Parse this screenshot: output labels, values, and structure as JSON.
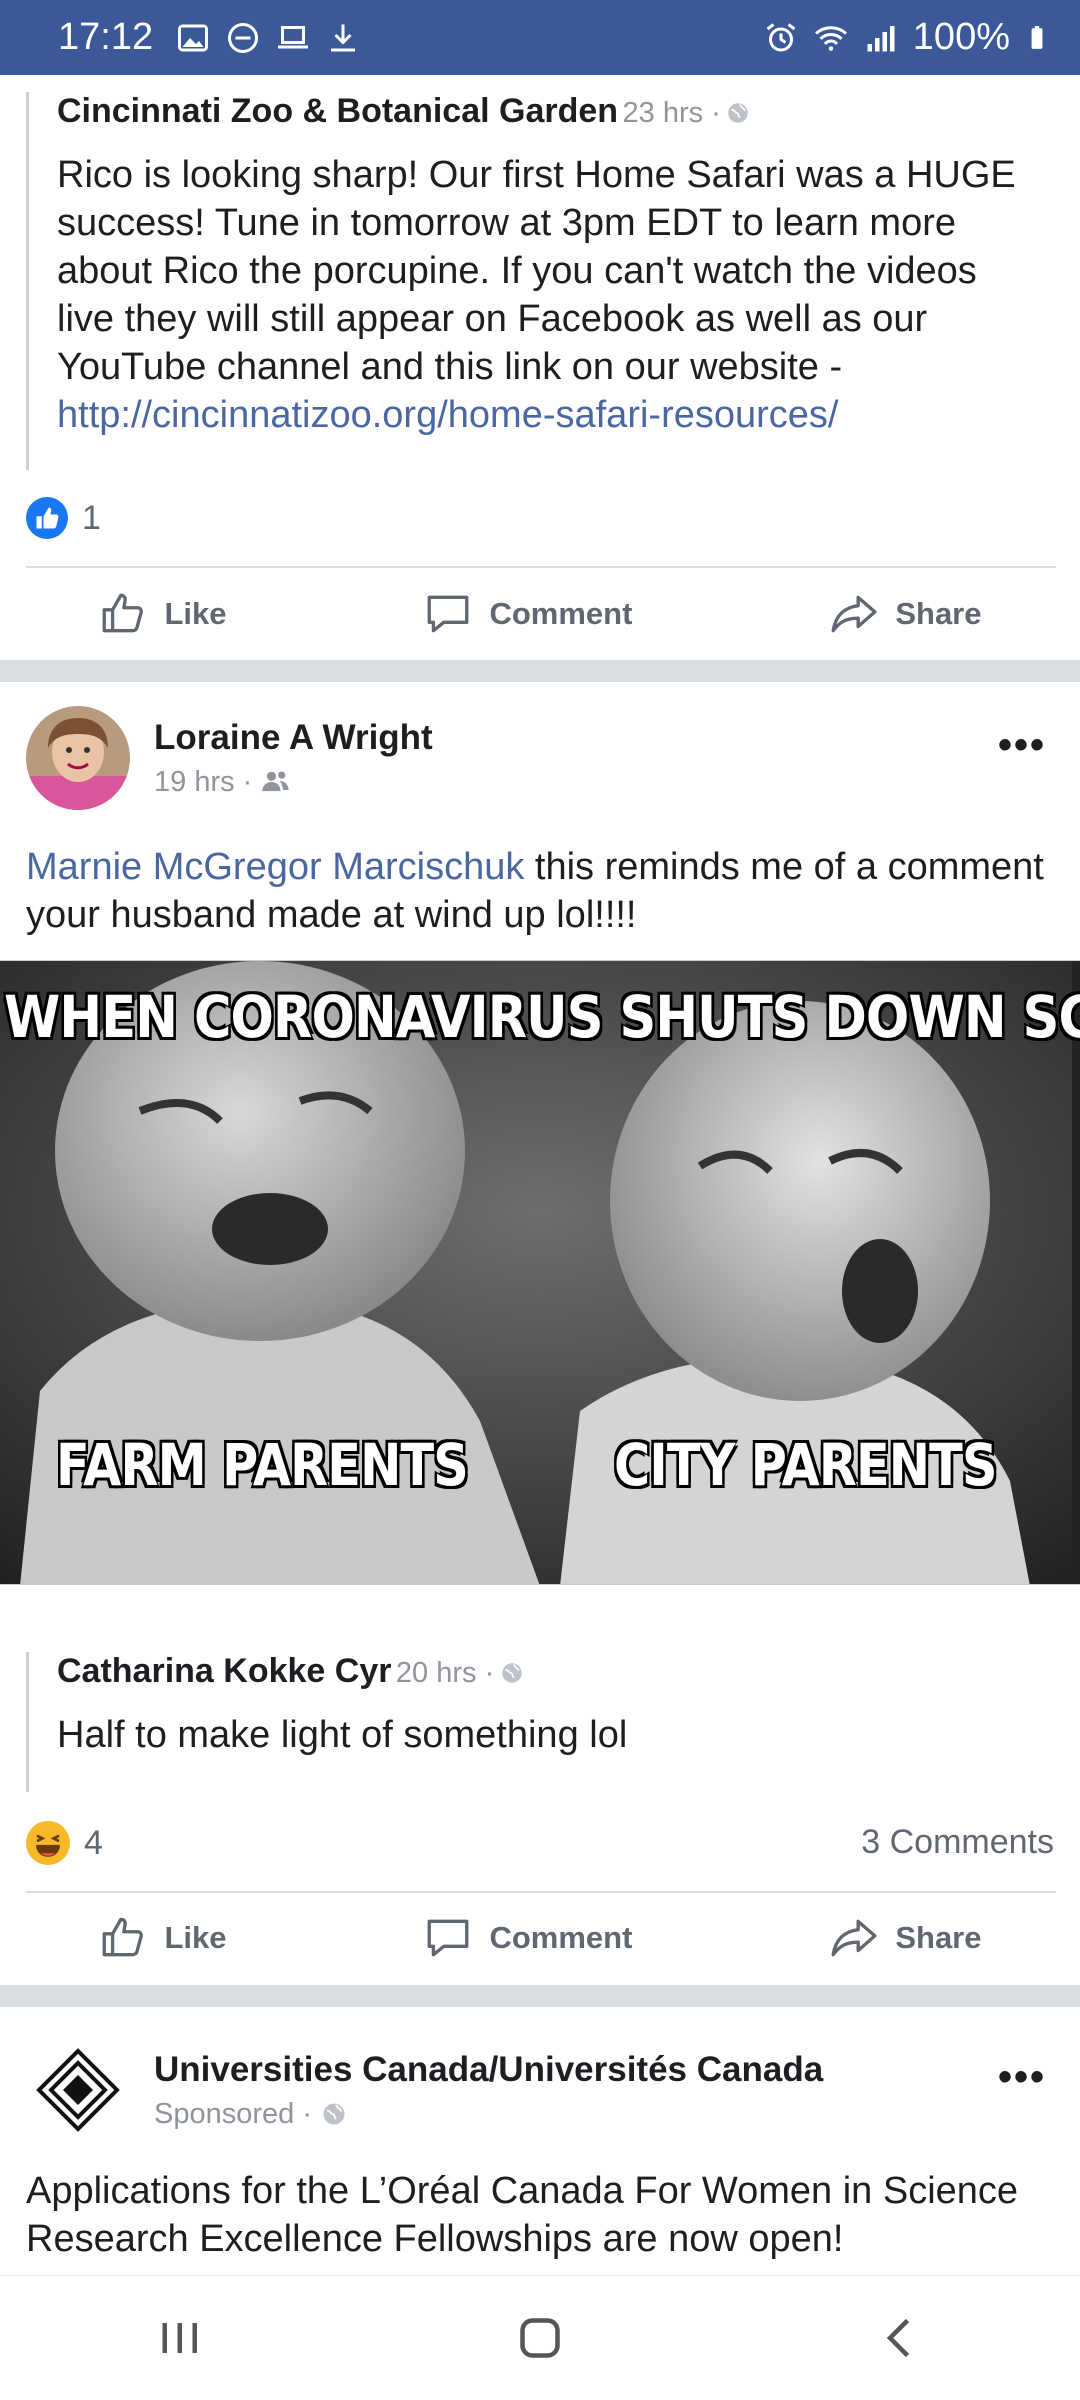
{
  "status_bar": {
    "time": "17:12",
    "battery": "100%",
    "left_icons": [
      "image-icon",
      "do-not-disturb-icon",
      "laptop-icon",
      "download-icon"
    ],
    "right_icons": [
      "alarm-icon",
      "wifi-icon",
      "signal-icon",
      "battery-icon"
    ]
  },
  "post1": {
    "shared": {
      "author": "Cincinnati Zoo & Botanical Garden",
      "meta": "23 hrs ·",
      "text": "Rico is looking sharp! Our first Home Safari was a HUGE success! Tune in tomorrow at 3pm EDT to learn more about Rico the porcupine. If you can't watch the videos live they will still appear on Facebook as well as our YouTube channel and this link on our website - ",
      "link": "http://cincinnatizoo.org/home-safari-resources/"
    },
    "reaction_count": "1",
    "reaction_icon": "like-reaction-icon"
  },
  "actions": {
    "like": "Like",
    "comment": "Comment",
    "share": "Share"
  },
  "post2": {
    "author": "Loraine A Wright",
    "meta": "19 hrs ·",
    "mention": "Marnie McGregor Marcischuk",
    "text": " this reminds me of a comment your husband made at wind up lol!!!!",
    "meme": {
      "top_caption": "WHEN CORONAVIRUS SHUTS DOWN SCHOOL..",
      "left_caption": "FARM PARENTS",
      "right_caption": "CITY PARENTS"
    },
    "shared": {
      "author": "Catharina Kokke Cyr",
      "meta": "20 hrs ·",
      "text": "Half to make light of something lol"
    },
    "reaction_count": "4",
    "reaction_icon": "haha-reaction-icon",
    "comments": "3 Comments"
  },
  "post3": {
    "author": "Universities Canada/Universités Canada",
    "meta": "Sponsored ·",
    "text": "Applications for the L’Oréal Canada For Women in Science Research Excellence Fellowships are now open!"
  },
  "colors": {
    "status_bar": "#3b5998",
    "link": "#4b67a1",
    "muted": "#606770",
    "divider": "#dadde1"
  }
}
